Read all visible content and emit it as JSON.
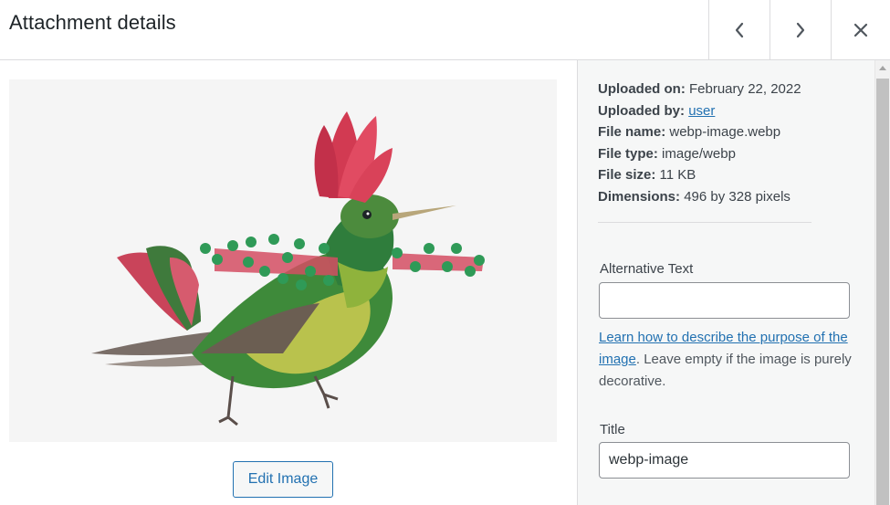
{
  "header": {
    "title": "Attachment details",
    "prev_icon": "chevron-left-icon",
    "next_icon": "chevron-right-icon",
    "close_icon": "close-icon"
  },
  "preview": {
    "image_subject": "hummingbird illustration",
    "edit_button_label": "Edit Image"
  },
  "details": {
    "uploaded_on_label": "Uploaded on:",
    "uploaded_on_value": "February 22, 2022",
    "uploaded_by_label": "Uploaded by:",
    "uploaded_by_value": "user",
    "file_name_label": "File name:",
    "file_name_value": "webp-image.webp",
    "file_type_label": "File type:",
    "file_type_value": "image/webp",
    "file_size_label": "File size:",
    "file_size_value": "11 KB",
    "dimensions_label": "Dimensions:",
    "dimensions_value": "496 by 328 pixels"
  },
  "form": {
    "alt_text_label": "Alternative Text",
    "alt_text_value": "",
    "help_link_text": "Learn how to describe the purpose of the image",
    "help_rest_text": ". Leave empty if the image is purely decorative.",
    "title_label": "Title",
    "title_value": "webp-image"
  },
  "colors": {
    "accent": "#2271b1",
    "border": "#dcdcde",
    "sidebar_bg": "#f6f7f7"
  }
}
